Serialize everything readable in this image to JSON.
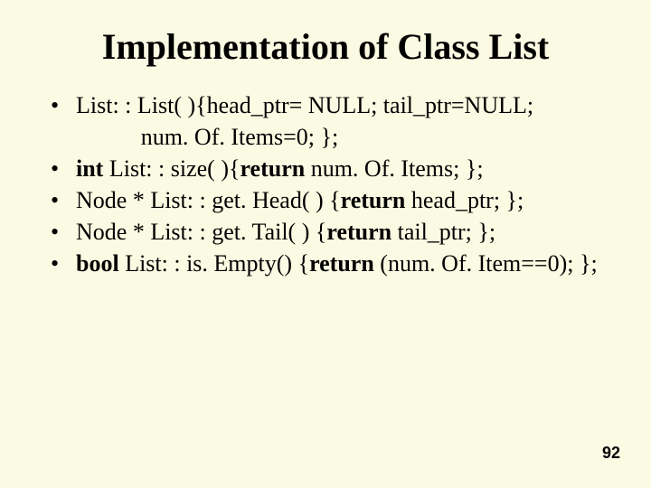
{
  "title": "Implementation of Class List",
  "bullets": {
    "b1_a": "List: : List( ){head_ptr= NULL; tail_ptr=NULL;",
    "b1_b": "num. Of. Items=0; };",
    "b2_pre": "int ",
    "b2_mid": "List: : size( ){",
    "b2_ret": "return ",
    "b2_post": "num. Of. Items; };",
    "b3_pre": "Node * List: : get. Head( ) {",
    "b3_ret": "return ",
    "b3_post": "head_ptr; };",
    "b4_pre": "Node * List: : get. Tail( ) {",
    "b4_ret": "return ",
    "b4_post": "tail_ptr; };",
    "b5_pre": "bool ",
    "b5_mid": "List: : is. Empty() {",
    "b5_ret": "return ",
    "b5_post": "(num. Of. Item==0); };"
  },
  "page_number": "92"
}
